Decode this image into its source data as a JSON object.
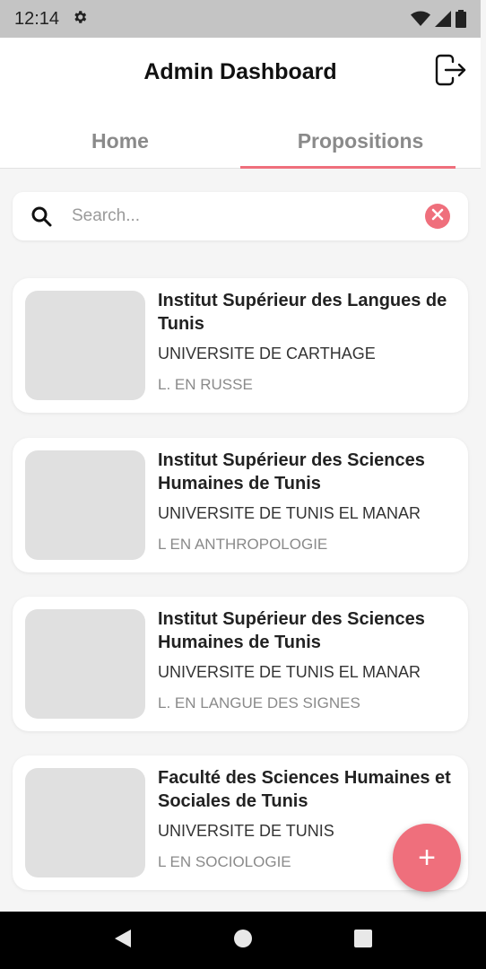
{
  "status_bar": {
    "time": "12:14",
    "icons": [
      "settings-icon",
      "wifi-icon",
      "signal-icon",
      "battery-icon"
    ]
  },
  "app_bar": {
    "title": "Admin Dashboard",
    "logout_icon": "logout-icon"
  },
  "tabs": [
    {
      "label": "Home",
      "active": false
    },
    {
      "label": "Propositions",
      "active": true
    }
  ],
  "search": {
    "placeholder": "Search...",
    "value": "",
    "icon": "search-icon",
    "clear_icon": "clear-icon"
  },
  "cards": [
    {
      "title": "Institut Supérieur des Langues de Tunis",
      "university": "UNIVERSITE DE CARTHAGE",
      "program": "L. EN RUSSE"
    },
    {
      "title": "Institut Supérieur des Sciences Humaines de Tunis",
      "university": "UNIVERSITE DE TUNIS EL MANAR",
      "program": "L EN ANTHROPOLOGIE"
    },
    {
      "title": "Institut Supérieur des Sciences Humaines de Tunis",
      "university": "UNIVERSITE DE TUNIS EL MANAR",
      "program": "L. EN LANGUE DES SIGNES"
    },
    {
      "title": "Faculté des Sciences Humaines et Sociales de Tunis",
      "university": "UNIVERSITE DE TUNIS",
      "program": "L EN SOCIOLOGIE"
    }
  ],
  "fab": {
    "label": "+",
    "icon": "add-icon"
  },
  "colors": {
    "accent": "#ef6f7c",
    "background": "#f5f5f5",
    "status_bar": "#c4c4c4",
    "nav_bar": "#000000"
  }
}
